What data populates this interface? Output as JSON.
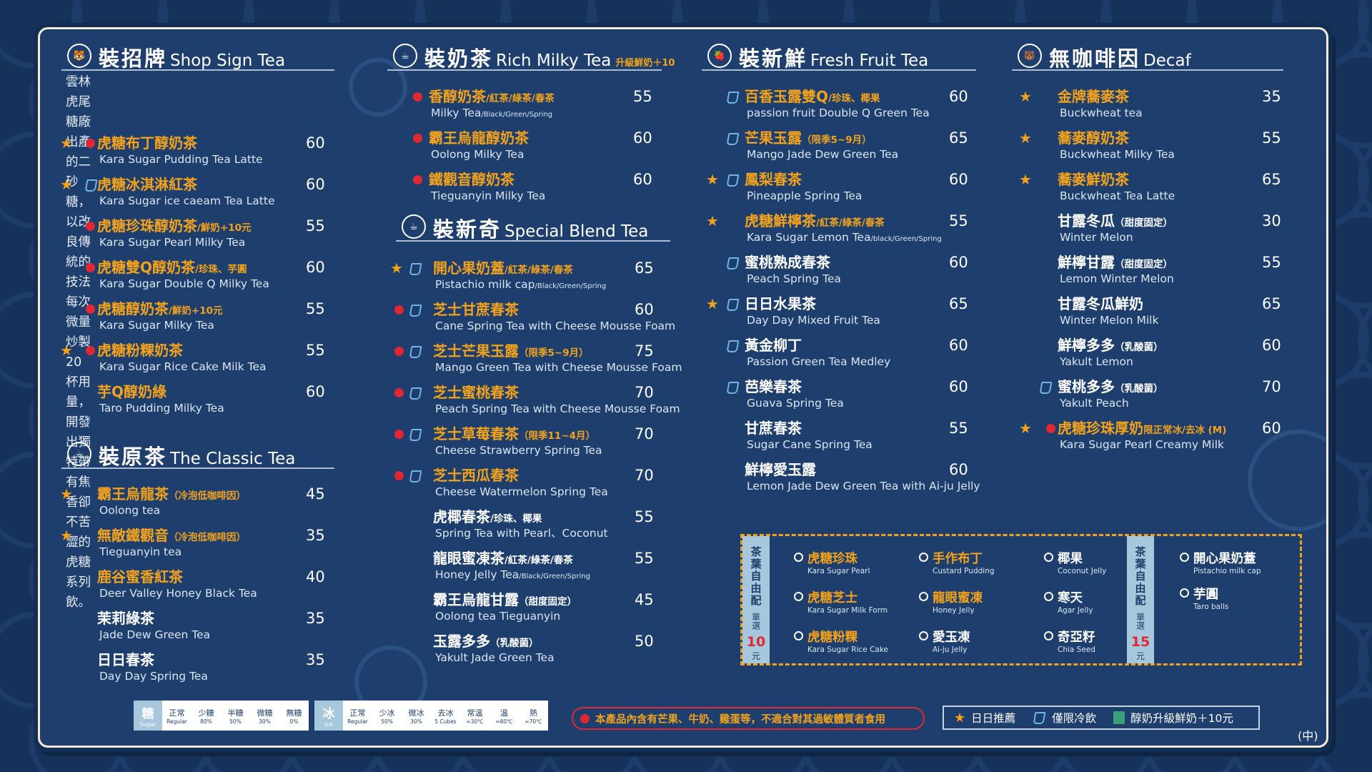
{
  "colors": {
    "background": "#17325a",
    "board": "#1e3f6d",
    "gold": "#f2a21c",
    "red": "#e02733",
    "light_blue": "#6fb6e6"
  },
  "shop_sign": {
    "zh": "裝招牌",
    "en": "Shop Sign Tea",
    "icon": "tiger-icon",
    "desc_lines": [
      "雲林虎尾糖廠出產的二砂糖，以改良傳統的",
      "技法每次微量炒製20杯用量，開發出獨特帶",
      "有焦香卻不苦澀的虎糖系列飲。"
    ],
    "items": [
      {
        "zh": "虎糖布丁醇奶茶",
        "sub": "",
        "en": "Kara Sugar Pudding Tea Latte",
        "en_sub": "",
        "price": "60",
        "star": true,
        "dot": true,
        "cup": false
      },
      {
        "zh": "虎糖冰淇淋紅茶",
        "sub": "",
        "en": "Kara Sugar ice caeam Tea Latte",
        "en_sub": "",
        "price": "60",
        "star": true,
        "dot": false,
        "cup": true
      },
      {
        "zh": "虎糖珍珠醇奶茶",
        "sub": "/鮮奶+10元",
        "en": "Kara Sugar Pearl Milky Tea",
        "en_sub": "",
        "price": "55",
        "star": false,
        "dot": true,
        "cup": false
      },
      {
        "zh": "虎糖雙Q醇奶茶",
        "sub": "/珍珠、芋圓",
        "en": "Kara Sugar Double Q Milky Tea",
        "en_sub": "",
        "price": "60",
        "star": false,
        "dot": true,
        "cup": false
      },
      {
        "zh": "虎糖醇奶茶",
        "sub": "/鮮奶+10元",
        "en": "Kara Sugar Milky Tea",
        "en_sub": "",
        "price": "55",
        "star": false,
        "dot": true,
        "cup": false
      },
      {
        "zh": "虎糖粉粿奶茶",
        "sub": "",
        "en": "Kara Sugar Rice Cake Milk Tea",
        "en_sub": "",
        "price": "55",
        "star": true,
        "dot": true,
        "cup": false
      },
      {
        "zh": "芋Q醇奶綠",
        "sub": "",
        "en": "Taro Pudding Milky Tea",
        "en_sub": "",
        "price": "60",
        "star": false,
        "dot": false,
        "cup": false
      }
    ]
  },
  "classic": {
    "zh": "裝原茶",
    "en": "The Classic Tea",
    "icon": "cup-icon",
    "items": [
      {
        "zh": "霸王烏龍茶",
        "sub": "（冷泡低咖啡因）",
        "en": "Oolong tea",
        "en_sub": "",
        "price": "45",
        "star": true,
        "gold": true
      },
      {
        "zh": "無敵鐵觀音",
        "sub": "（冷泡低咖啡因）",
        "en": "Tieguanyin tea",
        "en_sub": "",
        "price": "35",
        "star": true,
        "gold": true
      },
      {
        "zh": "鹿谷蜜香紅茶",
        "sub": "",
        "en": "Deer Valley Honey Black Tea",
        "en_sub": "",
        "price": "40",
        "star": false,
        "gold": true
      },
      {
        "zh": "茉莉綠茶",
        "sub": "",
        "en": "Jade Dew Green Tea",
        "en_sub": "",
        "price": "35",
        "star": false,
        "gold": false
      },
      {
        "zh": "日日春茶",
        "sub": "",
        "en": "Day Day Spring Tea",
        "en_sub": "",
        "price": "35",
        "star": false,
        "gold": false
      }
    ]
  },
  "milky": {
    "zh": "裝奶茶",
    "en": "Rich Milky Tea",
    "extra": "升級鮮奶＋10",
    "icon": "cup-icon",
    "items": [
      {
        "zh": "香醇奶茶",
        "sub": "/紅茶/綠茶/春茶",
        "en": "Milky Tea",
        "en_sub": "/Black/Green/Spring",
        "price": "55",
        "dot": true
      },
      {
        "zh": "霸王烏龍醇奶茶",
        "sub": "",
        "en": "Oolong Milky Tea",
        "en_sub": "",
        "price": "60",
        "dot": true
      },
      {
        "zh": "鐵觀音醇奶茶",
        "sub": "",
        "en": "Tieguanyin Milky Tea",
        "en_sub": "",
        "price": "60",
        "dot": true
      }
    ]
  },
  "special": {
    "zh": "裝新奇",
    "en": "Special Blend Tea",
    "icon": "cup-icon",
    "items": [
      {
        "zh": "開心果奶蓋",
        "sub": "/紅茶/綠茶/春茶",
        "en": "Pistachio milk cap",
        "en_sub": "/Black/Green/Spring",
        "price": "65",
        "star": true,
        "dot": false,
        "cup": true,
        "gold": true
      },
      {
        "zh": "芝士甘蔗春茶",
        "sub": "",
        "en": "Cane Spring Tea with Cheese Mousse Foam",
        "en_sub": "",
        "price": "60",
        "star": false,
        "dot": true,
        "cup": true,
        "gold": true
      },
      {
        "zh": "芝士芒果玉露",
        "sub": "（限季5~9月）",
        "en": "Mango Green Tea with Cheese Mousse Foam",
        "en_sub": "",
        "price": "75",
        "star": false,
        "dot": true,
        "cup": true,
        "gold": true
      },
      {
        "zh": "芝士蜜桃春茶",
        "sub": "",
        "en": "Peach Spring Tea with Cheese Mousse Foam",
        "en_sub": "",
        "price": "70",
        "star": false,
        "dot": true,
        "cup": true,
        "gold": true
      },
      {
        "zh": "芝士草莓春茶",
        "sub": "（限季11~4月）",
        "en": "Cheese Strawberry Spring Tea",
        "en_sub": "",
        "price": "70",
        "star": false,
        "dot": true,
        "cup": true,
        "gold": true
      },
      {
        "zh": "芝士西瓜春茶",
        "sub": "",
        "en": "Cheese Watermelon Spring Tea",
        "en_sub": "",
        "price": "70",
        "star": false,
        "dot": true,
        "cup": true,
        "gold": true
      },
      {
        "zh": "虎椰春茶",
        "sub": "/珍珠、椰果",
        "en": "Spring Tea with Pearl、Coconut",
        "en_sub": "",
        "price": "55",
        "star": false,
        "dot": false,
        "cup": false,
        "gold": false
      },
      {
        "zh": "龍眼蜜凍茶",
        "sub": "/紅茶/綠茶/春茶",
        "en": "Honey Jelly Tea",
        "en_sub": "/Black/Green/Spring",
        "price": "55",
        "star": false,
        "dot": false,
        "cup": false,
        "gold": false
      },
      {
        "zh": "霸王烏龍甘露",
        "sub": "（甜度固定）",
        "en": "Oolong tea Tieguanyin",
        "en_sub": "",
        "price": "45",
        "star": false,
        "dot": false,
        "cup": false,
        "gold": false
      },
      {
        "zh": "玉露多多",
        "sub": "（乳酸菌）",
        "en": "Yakult Jade Green Tea",
        "en_sub": "",
        "price": "50",
        "star": false,
        "dot": false,
        "cup": false,
        "gold": false
      }
    ]
  },
  "fruit": {
    "zh": "裝新鮮",
    "en": "Fresh Fruit Tea",
    "icon": "fruit-icon",
    "items": [
      {
        "zh": "百香玉露雙Q",
        "sub": "/珍珠、椰果",
        "en": "passion fruit Double Q Green Tea",
        "en_sub": "",
        "price": "60",
        "star": false,
        "cup": true,
        "gold": true
      },
      {
        "zh": "芒果玉露",
        "sub": "（限季5~9月）",
        "en": "Mango Jade Dew Green Tea",
        "en_sub": "",
        "price": "65",
        "star": false,
        "cup": true,
        "gold": true
      },
      {
        "zh": "鳳梨春茶",
        "sub": "",
        "en": "Pineapple Spring Tea",
        "en_sub": "",
        "price": "60",
        "star": true,
        "cup": true,
        "gold": true
      },
      {
        "zh": "虎糖鮮檸茶",
        "sub": "/紅茶/綠茶/春茶",
        "en": "Kara Sugar Lemon Tea",
        "en_sub": "/black/Green/Spring",
        "price": "55",
        "star": true,
        "cup": false,
        "gold": true
      },
      {
        "zh": "蜜桃熟成春茶",
        "sub": "",
        "en": "Peach Spring Tea",
        "en_sub": "",
        "price": "60",
        "star": false,
        "cup": true,
        "gold": false
      },
      {
        "zh": "日日水果茶",
        "sub": "",
        "en": "Day Day Mixed Fruit Tea",
        "en_sub": "",
        "price": "65",
        "star": true,
        "cup": true,
        "gold": false
      },
      {
        "zh": "黃金柳丁",
        "sub": "",
        "en": "Passion Green Tea Medley",
        "en_sub": "",
        "price": "60",
        "star": false,
        "cup": true,
        "gold": false
      },
      {
        "zh": "芭樂春茶",
        "sub": "",
        "en": "Guava Spring Tea",
        "en_sub": "",
        "price": "60",
        "star": false,
        "cup": true,
        "gold": false
      },
      {
        "zh": "甘蔗春茶",
        "sub": "",
        "en": "Sugar Cane Spring Tea",
        "en_sub": "",
        "price": "55",
        "star": false,
        "cup": false,
        "gold": false
      },
      {
        "zh": "鮮檸愛玉露",
        "sub": "",
        "en": "Lemon Jade Dew Green Tea with Ai-ju Jelly",
        "en_sub": "",
        "price": "60",
        "star": false,
        "cup": false,
        "gold": false
      }
    ]
  },
  "decaf": {
    "zh": "無咖啡因",
    "en": "Decaf",
    "icon": "bear-icon",
    "items": [
      {
        "zh": "金牌蕎麥茶",
        "sub": "",
        "en": "Buckwheat tea",
        "price": "35",
        "star": true,
        "dot": false,
        "cup": false,
        "gold": true
      },
      {
        "zh": "蕎麥醇奶茶",
        "sub": "",
        "en": "Buckwheat Milky Tea",
        "price": "55",
        "star": true,
        "dot": false,
        "cup": false,
        "gold": true
      },
      {
        "zh": "蕎麥鮮奶茶",
        "sub": "",
        "en": "Buckwheat Tea Latte",
        "price": "65",
        "star": true,
        "dot": false,
        "cup": false,
        "gold": true
      },
      {
        "zh": "甘露冬瓜",
        "sub": "（甜度固定）",
        "en": "Winter Melon",
        "price": "30",
        "star": false,
        "dot": false,
        "cup": false,
        "gold": false
      },
      {
        "zh": "鮮檸甘露",
        "sub": "（甜度固定）",
        "en": "Lemon Winter Melon",
        "price": "55",
        "star": false,
        "dot": false,
        "cup": false,
        "gold": false
      },
      {
        "zh": "甘露冬瓜鮮奶",
        "sub": "",
        "en": "Winter Melon Milk",
        "price": "65",
        "star": false,
        "dot": false,
        "cup": false,
        "gold": false
      },
      {
        "zh": "鮮檸多多",
        "sub": "（乳酸菌）",
        "en": "Yakult Lemon",
        "price": "60",
        "star": false,
        "dot": false,
        "cup": false,
        "gold": false
      },
      {
        "zh": "蜜桃多多",
        "sub": "（乳酸菌）",
        "en": "Yakult Peach",
        "price": "70",
        "star": false,
        "dot": false,
        "cup": true,
        "gold": false
      },
      {
        "zh": "虎糖珍珠厚奶",
        "sub": "限正常冰/去冰 (M)",
        "en": "Kara Sugar Pearl Creamy Milk",
        "price": "60",
        "star": true,
        "dot": true,
        "cup": false,
        "gold": true
      }
    ]
  },
  "toppings": {
    "tag10": {
      "vertical": "茶葉自由配",
      "single": "單選",
      "price": "10",
      "unit": "元"
    },
    "tag15": {
      "vertical": "茶葉自由配",
      "single": "單選",
      "price": "15",
      "unit": "元"
    },
    "list10": [
      {
        "zh": "虎糖珍珠",
        "en": "Kara Sugar Pearl",
        "gold": true
      },
      {
        "zh": "虎糖芝士",
        "en": "Kara Sugar Milk Form",
        "gold": true
      },
      {
        "zh": "虎糖粉粿",
        "en": "Kara Sugar Rice Cake",
        "gold": true
      },
      {
        "zh": "手作布丁",
        "en": "Custard Pudding",
        "gold": true
      },
      {
        "zh": "龍眼蜜凍",
        "en": "Honey Jelly",
        "gold": true
      },
      {
        "zh": "愛玉凍",
        "en": "Ai-ju Jelly",
        "gold": false
      },
      {
        "zh": "椰果",
        "en": "Coconut Jelly",
        "gold": false
      },
      {
        "zh": "寒天",
        "en": "Agar Jelly",
        "gold": false
      },
      {
        "zh": "奇亞籽",
        "en": "Chia Seed",
        "gold": false
      }
    ],
    "list15": [
      {
        "zh": "開心果奶蓋",
        "en": "Pistachio milk cap",
        "gold": false
      },
      {
        "zh": "芋圓",
        "en": "Taro balls",
        "gold": false
      }
    ]
  },
  "sugar_scale": {
    "label": "糖",
    "label_en": "Sugar",
    "levels": [
      {
        "zh": "正常",
        "en": "Regular"
      },
      {
        "zh": "少糖",
        "en": "80%"
      },
      {
        "zh": "半糖",
        "en": "50%"
      },
      {
        "zh": "微糖",
        "en": "30%"
      },
      {
        "zh": "無糖",
        "en": "0%"
      }
    ]
  },
  "ice_scale": {
    "label": "冰",
    "label_en": "Ice",
    "levels": [
      {
        "zh": "正常",
        "en": "Regular"
      },
      {
        "zh": "少冰",
        "en": "50%"
      },
      {
        "zh": "微冰",
        "en": "30%"
      },
      {
        "zh": "去冰",
        "en": "5 Cubes"
      },
      {
        "zh": "常溫",
        "en": "≈30℃"
      },
      {
        "zh": "溫",
        "en": "≈60℃"
      },
      {
        "zh": "熱",
        "en": "≈70℃"
      }
    ]
  },
  "allergy": "本產品內含有芒果、牛奶、雞蛋等，不適合對其過敏體質者食用",
  "legend": {
    "star": "日日推薦",
    "cold": "僅限冷飲",
    "milk": "醇奶升級鮮奶＋10元"
  },
  "branch": "(中)"
}
